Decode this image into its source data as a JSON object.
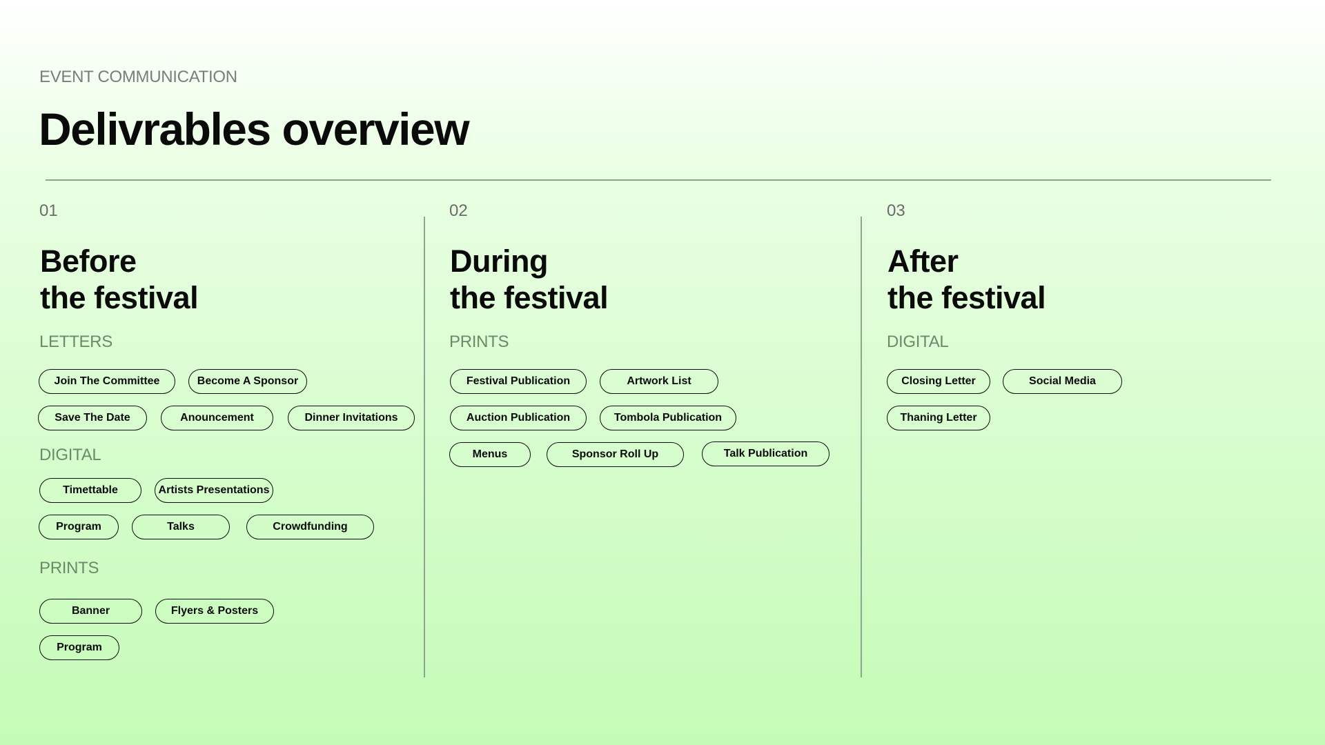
{
  "header": {
    "eyebrow": "EVENT COMMUNICATION",
    "title": "Delivrables overview"
  },
  "columns": [
    {
      "number": "01",
      "title_line1": "Before",
      "title_line2": "the festival",
      "categories": [
        {
          "label": "LETTERS",
          "items": [
            "Join The Committee",
            "Become A Sponsor",
            "Save The Date",
            "Anouncement",
            "Dinner Invitations"
          ]
        },
        {
          "label": "DIGITAL",
          "items": [
            "Timettable",
            "Artists Presentations",
            "Program",
            "Talks",
            "Crowdfunding"
          ]
        },
        {
          "label": "PRINTS",
          "items": [
            "Banner",
            "Flyers & Posters",
            "Program"
          ]
        }
      ]
    },
    {
      "number": "02",
      "title_line1": "During",
      "title_line2": "the festival",
      "categories": [
        {
          "label": "PRINTS",
          "items": [
            "Festival Publication",
            "Artwork List",
            "Auction Publication",
            "Tombola Publication",
            "Menus",
            "Sponsor Roll Up",
            "Talk Publication"
          ]
        }
      ]
    },
    {
      "number": "03",
      "title_line1": "After",
      "title_line2": "the festival",
      "categories": [
        {
          "label": "DIGITAL",
          "items": [
            "Closing Letter",
            "Social Media",
            "Thaning Letter"
          ]
        }
      ]
    }
  ],
  "colors": {
    "gradient_top": "#ffffff",
    "gradient_bottom": "#c4fcb6",
    "category_label": "#6c8a6b",
    "divider": "#8da58c",
    "tag_border": "#0a0a0a"
  }
}
